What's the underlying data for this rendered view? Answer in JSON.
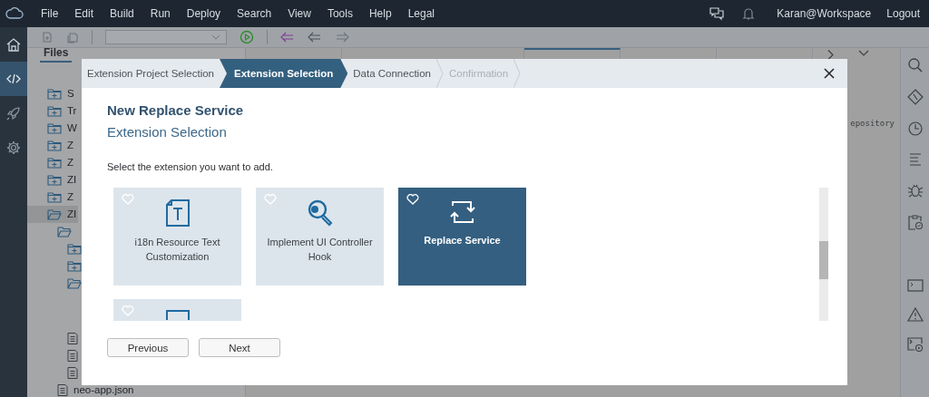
{
  "menubar": {
    "menus": [
      "File",
      "Edit",
      "Build",
      "Run",
      "Deploy",
      "Search",
      "View",
      "Tools",
      "Help",
      "Legal"
    ],
    "user": "Karan@Workspace",
    "logout": "Logout"
  },
  "left_rail": [
    {
      "kind": "home",
      "selected": false
    },
    {
      "kind": "code",
      "selected": true
    },
    {
      "kind": "rocket",
      "selected": false
    },
    {
      "kind": "gear",
      "selected": false
    }
  ],
  "explorer": {
    "tabs": [
      {
        "label": "Files",
        "selected": true
      }
    ],
    "tree": [
      {
        "kind": "folder",
        "label": "S",
        "expanded": false,
        "selected": false
      },
      {
        "kind": "folder",
        "label": "Tr",
        "expanded": false,
        "selected": false
      },
      {
        "kind": "folder",
        "label": "W",
        "expanded": false,
        "selected": false
      },
      {
        "kind": "folder",
        "label": "Z",
        "expanded": false,
        "selected": false
      },
      {
        "kind": "folder",
        "label": "Z",
        "expanded": false,
        "selected": false
      },
      {
        "kind": "folder",
        "label": "ZI",
        "expanded": false,
        "selected": false
      },
      {
        "kind": "folder",
        "label": "Z",
        "expanded": false,
        "selected": false
      },
      {
        "kind": "folder",
        "label": "ZI",
        "expanded": true,
        "selected": true,
        "children": [
          {
            "kind": "folder",
            "expanded": true,
            "selected": false,
            "children": [
              {
                "kind": "folder",
                "expanded": false,
                "selected": false
              },
              {
                "kind": "folder",
                "expanded": false,
                "selected": false
              },
              {
                "kind": "folder",
                "expanded": true,
                "selected": false
              },
              {
                "kind": "file",
                "selected": false
              },
              {
                "kind": "file",
                "selected": false
              },
              {
                "kind": "file",
                "selected": false
              }
            ]
          },
          {
            "kind": "file",
            "label": "neo-app.json",
            "selected": false
          }
        ]
      }
    ]
  },
  "editor": {
    "tabs": [
      {
        "selected": false
      },
      {
        "selected": false
      },
      {
        "selected": true
      },
      {
        "selected": false
      },
      {
        "selected": false
      }
    ],
    "text": "epository"
  },
  "dialog": {
    "steps": [
      {
        "label": "Extension Project Selection",
        "selected": false,
        "disabled": false
      },
      {
        "label": "Extension Selection",
        "selected": true,
        "disabled": false
      },
      {
        "label": "Data Connection",
        "selected": false,
        "disabled": false
      },
      {
        "label": "Confirmation",
        "selected": false,
        "disabled": true
      }
    ],
    "title": "New Replace Service",
    "subtitle": "Extension Selection",
    "instruction": "Select the extension you want to add.",
    "tiles": [
      {
        "kind": "text-document",
        "label": "i18n Resource Text Customization",
        "selected": false
      },
      {
        "kind": "search-key",
        "label": "Implement UI Controller Hook",
        "selected": false
      },
      {
        "kind": "replace",
        "label": "Replace Service",
        "selected": true
      },
      {
        "kind": "document",
        "selected": false
      }
    ],
    "buttons": [
      "Previous",
      "Next"
    ]
  }
}
